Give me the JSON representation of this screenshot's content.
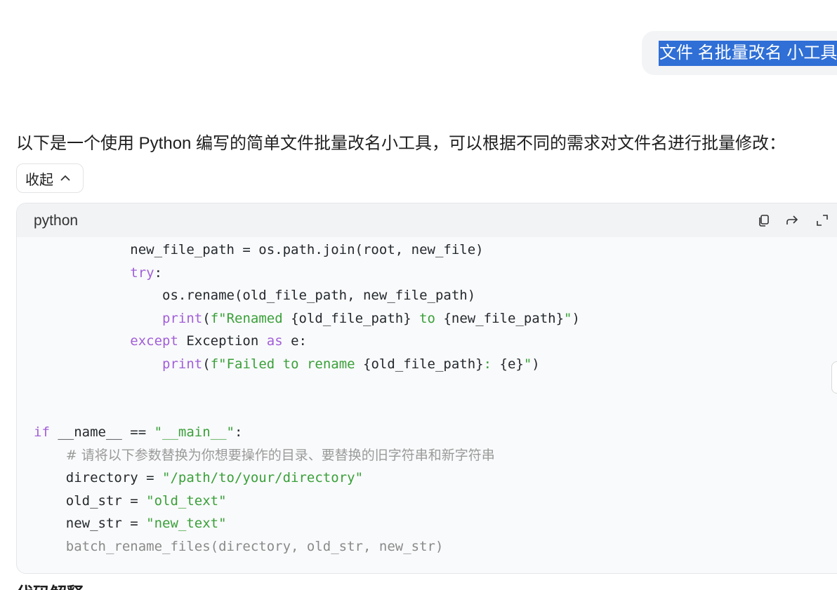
{
  "user_message": "文件 名批量改名 小工具",
  "assistant": {
    "intro": "以下是一个使用 Python 编写的简单文件批量改名小工具，可以根据不同的需求对文件名进行批量修改：",
    "collapse_label": "收起",
    "next_heading": "代码解释"
  },
  "code_block": {
    "language": "python",
    "icons": [
      "copy-icon",
      "share-icon",
      "expand-icon"
    ],
    "lines": [
      [
        {
          "t": "            new_file_path = os.path.join(root, new_file)"
        }
      ],
      [
        {
          "t": "            "
        },
        {
          "t": "try",
          "c": "kw"
        },
        {
          "t": ":"
        }
      ],
      [
        {
          "t": "                os.rename(old_file_path, new_file_path)"
        }
      ],
      [
        {
          "t": "                "
        },
        {
          "t": "print",
          "c": "kw"
        },
        {
          "t": "("
        },
        {
          "t": "f\"Renamed ",
          "c": "str"
        },
        {
          "t": "{old_file_path}"
        },
        {
          "t": " to ",
          "c": "str"
        },
        {
          "t": "{new_file_path}"
        },
        {
          "t": "\"",
          "c": "str"
        },
        {
          "t": ")"
        }
      ],
      [
        {
          "t": "            "
        },
        {
          "t": "except",
          "c": "kw"
        },
        {
          "t": " Exception "
        },
        {
          "t": "as",
          "c": "kw"
        },
        {
          "t": " e:"
        }
      ],
      [
        {
          "t": "                "
        },
        {
          "t": "print",
          "c": "kw"
        },
        {
          "t": "("
        },
        {
          "t": "f\"Failed to rename ",
          "c": "str"
        },
        {
          "t": "{old_file_path}"
        },
        {
          "t": ": ",
          "c": "str"
        },
        {
          "t": "{e}"
        },
        {
          "t": "\"",
          "c": "str"
        },
        {
          "t": ")"
        }
      ],
      [
        {
          "t": ""
        }
      ],
      [
        {
          "t": ""
        }
      ],
      [
        {
          "t": "if",
          "c": "kw"
        },
        {
          "t": " __name__ == "
        },
        {
          "t": "\"__main__\"",
          "c": "str"
        },
        {
          "t": ":"
        }
      ],
      [
        {
          "t": "    "
        },
        {
          "t": "# 请将以下参数替换为你想要操作的目录、要替换的旧字符串和新字符串",
          "c": "cmt"
        }
      ],
      [
        {
          "t": "    directory = "
        },
        {
          "t": "\"/path/to/your/directory\"",
          "c": "str"
        }
      ],
      [
        {
          "t": "    old_str = "
        },
        {
          "t": "\"old_text\"",
          "c": "str"
        }
      ],
      [
        {
          "t": "    new_str = "
        },
        {
          "t": "\"new_text\"",
          "c": "str"
        }
      ],
      [
        {
          "t": "    batch_rename_files(directory, old_str, new_str)",
          "c": "dim"
        }
      ]
    ]
  }
}
